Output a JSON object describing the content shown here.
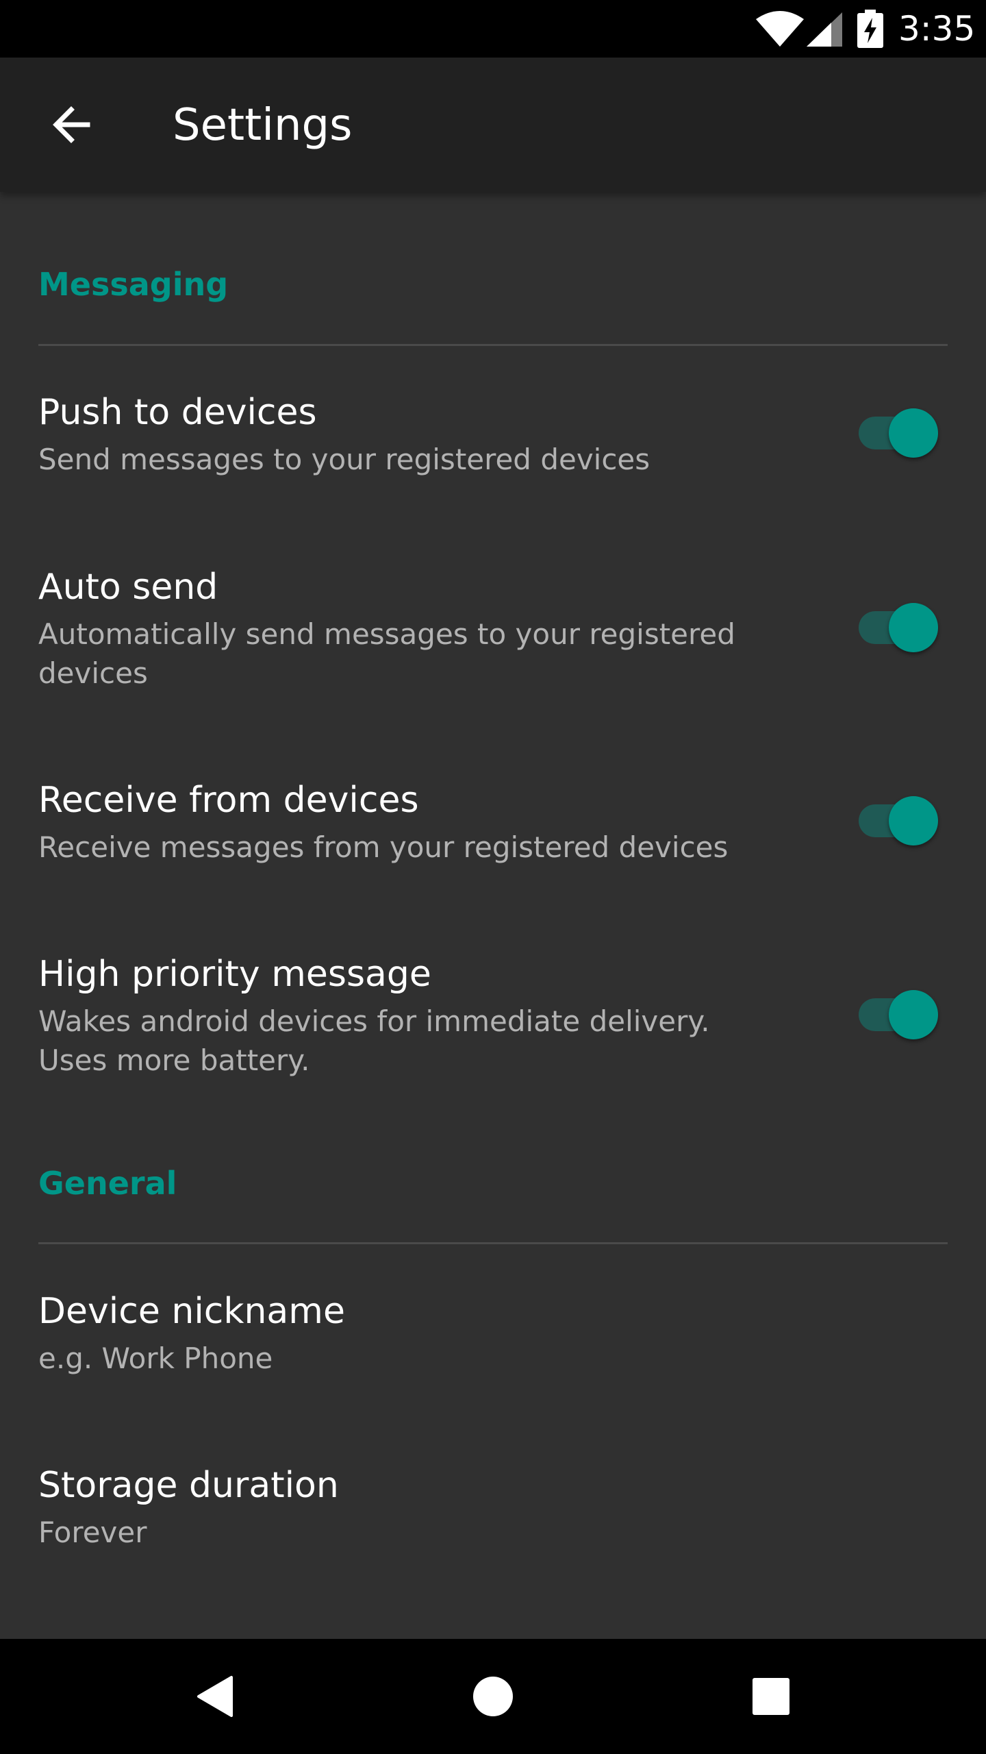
{
  "status_bar": {
    "time": "3:35",
    "icons": [
      "wifi-icon",
      "cell-signal-icon",
      "battery-charging-icon"
    ]
  },
  "app_bar": {
    "title": "Settings",
    "back_icon": "arrow-back-icon"
  },
  "sections": [
    {
      "header": "Messaging",
      "items": [
        {
          "title": "Push to devices",
          "summary": "Send messages to your registered devices",
          "toggle": true
        },
        {
          "title": "Auto send",
          "summary": "Automatically send messages to your registered devices",
          "toggle": true
        },
        {
          "title": "Receive from devices",
          "summary": "Receive messages from your registered devices",
          "toggle": true
        },
        {
          "title": "High priority message",
          "summary": "Wakes android devices for immediate delivery. Uses more battery.",
          "toggle": true
        }
      ]
    },
    {
      "header": "General",
      "items": [
        {
          "title": "Device nickname",
          "summary": "e.g. Work Phone"
        },
        {
          "title": "Storage duration",
          "summary": "Forever"
        }
      ]
    }
  ],
  "nav_bar": {
    "icons": [
      "nav-back-icon",
      "nav-home-icon",
      "nav-recents-icon"
    ]
  },
  "colors": {
    "accent": "#009688",
    "background": "#303030",
    "app_bar": "#212121",
    "secondary_text": "#b3b3b3"
  }
}
